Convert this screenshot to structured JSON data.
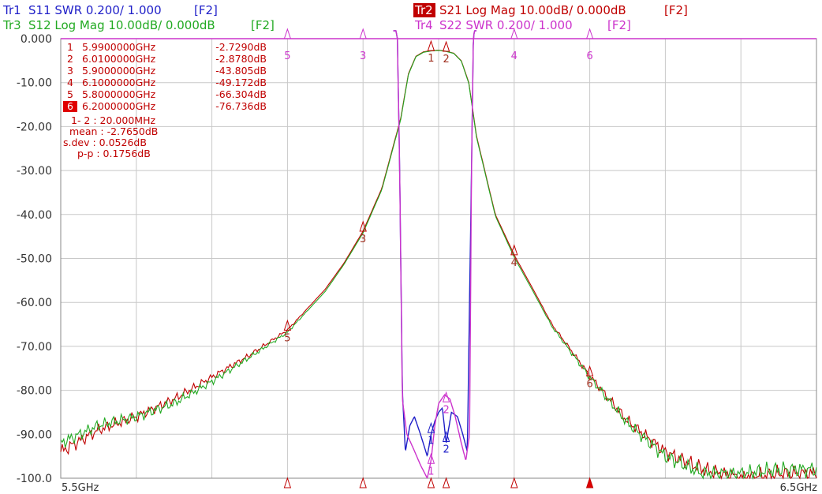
{
  "header": {
    "tr1": {
      "label": "Tr1",
      "text": "S11 SWR 0.200/ 1.000",
      "fkey": "[F2]",
      "color": "#1f1fc8"
    },
    "tr2": {
      "label": "Tr2",
      "text": "S21 Log Mag 10.00dB/ 0.000dB",
      "fkey": "[F2]",
      "color": "#c00000"
    },
    "tr3": {
      "label": "Tr3",
      "text": "S12 Log Mag 10.00dB/ 0.000dB",
      "fkey": "[F2]",
      "color": "#22aa22"
    },
    "tr4": {
      "label": "Tr4",
      "text": "S22 SWR 0.200/ 1.000",
      "fkey": "[F2]",
      "color": "#cc33cc"
    }
  },
  "marker_table": [
    {
      "num": "1",
      "freq": "5.9900000GHz",
      "value": "-2.7290dB",
      "active": false
    },
    {
      "num": "2",
      "freq": "6.0100000GHz",
      "value": "-2.8780dB",
      "active": false
    },
    {
      "num": "3",
      "freq": "5.9000000GHz",
      "value": "-43.805dB",
      "active": false
    },
    {
      "num": "4",
      "freq": "6.1000000GHz",
      "value": "-49.172dB",
      "active": false
    },
    {
      "num": "5",
      "freq": "5.8000000GHz",
      "value": "-66.304dB",
      "active": false
    },
    {
      "num": "6",
      "freq": "6.2000000GHz",
      "value": "-76.736dB",
      "active": true
    }
  ],
  "statistics": [
    "1- 2 : 20.000MHz",
    "mean : -2.7650dB",
    "s.dev : 0.0526dB",
    "p-p : 0.1756dB"
  ],
  "chart_data": {
    "type": "line",
    "title": "",
    "xlabel": "",
    "ylabel": "",
    "x_start_label": "5.5GHz",
    "x_stop_label": "6.5GHz",
    "xlim_ghz": [
      5.5,
      6.5
    ],
    "ylim_db": [
      -100,
      0
    ],
    "y_tick_labels": [
      "0.000",
      "-10.00",
      "-20.00",
      "-30.00",
      "-40.00",
      "-50.00",
      "-60.00",
      "-70.00",
      "-80.00",
      "-90.00",
      "-100.0"
    ],
    "grid": true,
    "series": [
      {
        "name": "S21",
        "color": "#c00000",
        "x": [
          5.5,
          5.55,
          5.6,
          5.65,
          5.7,
          5.75,
          5.8,
          5.85,
          5.875,
          5.9,
          5.925,
          5.95,
          5.96,
          5.97,
          5.98,
          5.99,
          6.0,
          6.01,
          6.02,
          6.03,
          6.04,
          6.05,
          6.075,
          6.1,
          6.125,
          6.15,
          6.2,
          6.25,
          6.3,
          6.35,
          6.4,
          6.45,
          6.5
        ],
        "y": [
          -94,
          -89,
          -86,
          -82,
          -77,
          -72,
          -66.3,
          -57,
          -51,
          -43.8,
          -34,
          -18,
          -8,
          -4,
          -3,
          -2.73,
          -2.6,
          -2.88,
          -3.3,
          -5,
          -10,
          -22,
          -40,
          -49.2,
          -57,
          -65,
          -76.7,
          -87,
          -94,
          -98,
          -100,
          -99,
          -99
        ]
      },
      {
        "name": "S12",
        "color": "#22aa22",
        "x": [
          5.5,
          5.55,
          5.6,
          5.65,
          5.7,
          5.75,
          5.8,
          5.85,
          5.875,
          5.9,
          5.925,
          5.95,
          5.96,
          5.97,
          5.98,
          5.99,
          6.0,
          6.01,
          6.02,
          6.03,
          6.04,
          6.05,
          6.075,
          6.1,
          6.125,
          6.15,
          6.2,
          6.25,
          6.3,
          6.35,
          6.4,
          6.45,
          6.5
        ],
        "y": [
          -92,
          -88,
          -86,
          -83,
          -78,
          -72.5,
          -66.8,
          -57.5,
          -51.3,
          -44.2,
          -34.3,
          -18.3,
          -8.2,
          -4.1,
          -3.1,
          -2.8,
          -2.65,
          -2.9,
          -3.35,
          -5.1,
          -10.2,
          -22.3,
          -40.3,
          -49.7,
          -57.5,
          -65.5,
          -77,
          -87.5,
          -95,
          -99,
          -99,
          -98,
          -98
        ]
      },
      {
        "name": "S11",
        "color": "#1f1fc8",
        "x": [
          5.94,
          5.9455,
          5.9485,
          5.952,
          5.956,
          5.962,
          5.968,
          5.976,
          5.985,
          5.99,
          5.995,
          6.0,
          6.005,
          6.01,
          6.017,
          6.025,
          6.032,
          6.038,
          6.0435,
          6.046,
          6.05
        ],
        "y": [
          5,
          0,
          -30,
          -80,
          -94,
          -88,
          -86,
          -90,
          -95,
          -90,
          -87,
          -85,
          -84,
          -92,
          -85,
          -86,
          -90,
          -94,
          -30,
          0,
          5
        ]
      },
      {
        "name": "S22",
        "color": "#cc33cc",
        "x": [
          5.94,
          5.9455,
          5.9485,
          5.952,
          5.958,
          5.966,
          5.976,
          5.985,
          5.99,
          5.995,
          6.0,
          6.008,
          6.015,
          6.022,
          6.03,
          6.036,
          6.041,
          6.0435,
          6.046,
          6.05
        ],
        "y": [
          5,
          0,
          -30,
          -82,
          -90,
          -93,
          -97,
          -100,
          -96,
          -88,
          -83,
          -81,
          -82,
          -86,
          -92,
          -96,
          -90,
          -30,
          0,
          5
        ]
      }
    ],
    "markers": [
      {
        "num": "1",
        "x": 5.99,
        "y": -2.729
      },
      {
        "num": "2",
        "x": 6.01,
        "y": -2.878
      },
      {
        "num": "3",
        "x": 5.9,
        "y": -43.805
      },
      {
        "num": "4",
        "x": 6.1,
        "y": -49.172
      },
      {
        "num": "5",
        "x": 5.8,
        "y": -66.304
      },
      {
        "num": "6",
        "x": 6.2,
        "y": -76.736
      }
    ],
    "markers_s22": [
      {
        "num": "1",
        "x": 5.99,
        "y": -97
      },
      {
        "num": "2",
        "x": 6.01,
        "y": -83
      },
      {
        "num": "3",
        "x": 5.9,
        "y": 0
      },
      {
        "num": "4",
        "x": 6.1,
        "y": 0
      },
      {
        "num": "5",
        "x": 5.8,
        "y": 0
      },
      {
        "num": "6",
        "x": 6.2,
        "y": 0
      }
    ],
    "markers_s11": [
      {
        "num": "1",
        "x": 5.99,
        "y": -90
      },
      {
        "num": "2",
        "x": 6.01,
        "y": -92
      }
    ]
  }
}
